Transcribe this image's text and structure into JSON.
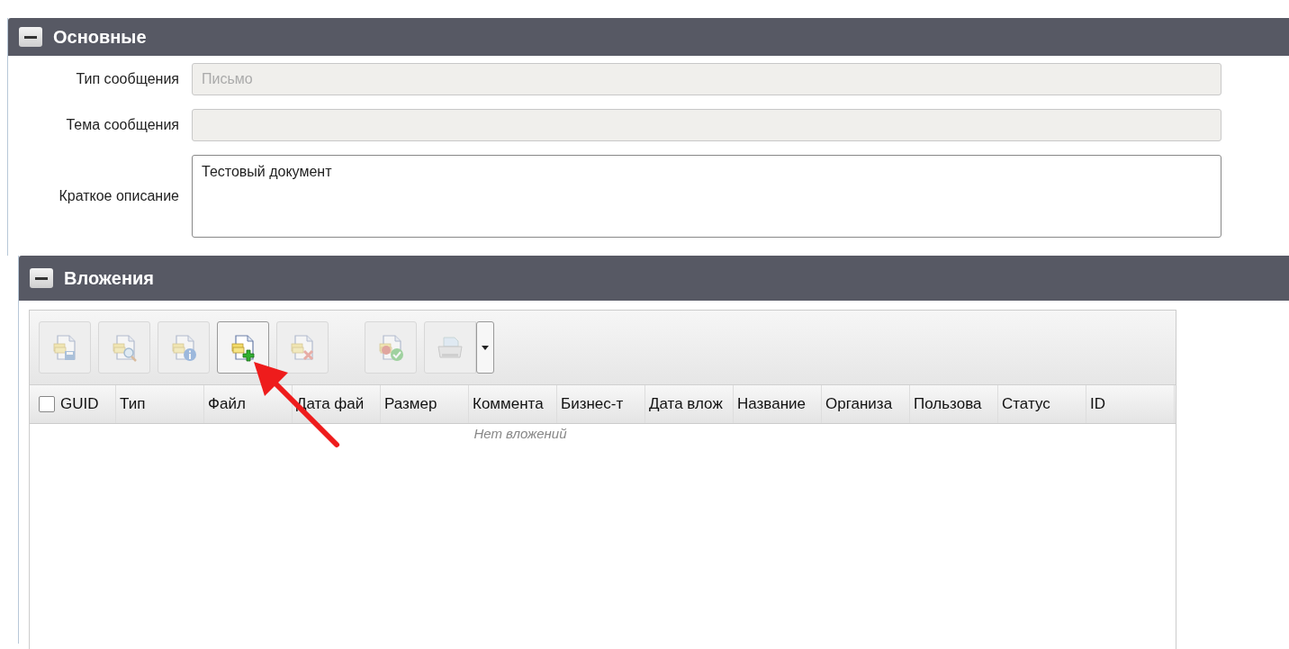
{
  "sections": [
    {
      "title": "Основные",
      "expanded": true,
      "fields": [
        {
          "label": "Тип сообщения",
          "kind": "input",
          "value": "Письмо",
          "disabled": true
        },
        {
          "label": "Тема сообщения",
          "kind": "input",
          "disabled": true
        },
        {
          "label": "Краткое описание",
          "kind": "textarea",
          "value": "Тестовый документ",
          "disabled": false
        }
      ]
    },
    {
      "title": "Вложения",
      "expanded": true,
      "toolbar": [
        {
          "kind": "save",
          "disabled": true,
          "selected": false
        },
        {
          "kind": "view",
          "disabled": true,
          "selected": false
        },
        {
          "kind": "info",
          "disabled": true,
          "selected": false
        },
        {
          "kind": "add",
          "disabled": false,
          "selected": true
        },
        {
          "kind": "delete",
          "disabled": true,
          "selected": false
        },
        {
          "kind": "sign",
          "disabled": true,
          "selected": false
        },
        {
          "kind": "print",
          "disabled": true,
          "selected": false
        }
      ],
      "table": {
        "select_all": {
          "checked": false
        },
        "columns": [
          "GUID",
          "Тип",
          "Файл",
          "Дата фай",
          "Размер",
          "Коммента",
          "Бизнес-т",
          "Дата влож",
          "Название",
          "Организа",
          "Пользова",
          "Статус",
          "ID"
        ],
        "empty_text": "Нет вложений"
      }
    }
  ]
}
